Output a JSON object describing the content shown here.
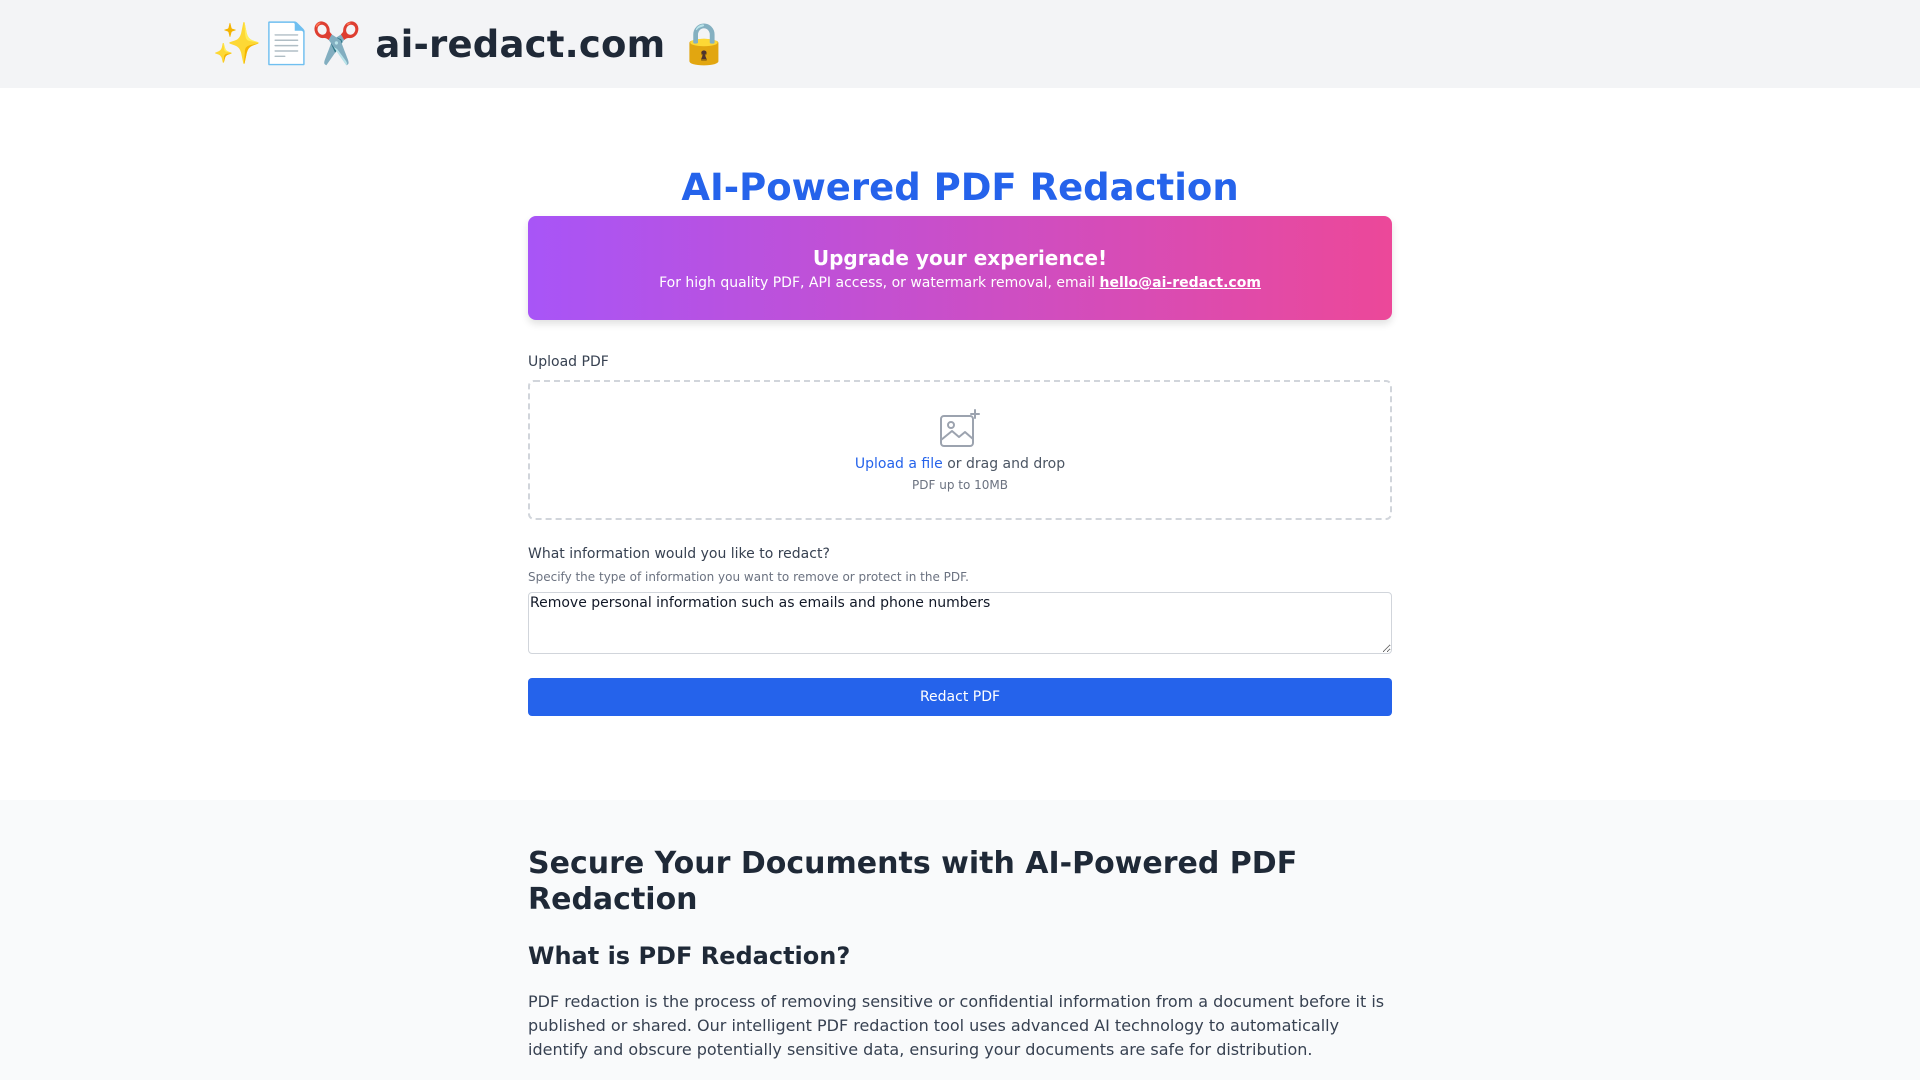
{
  "header": {
    "logo_emoji_left": "✨📄✂️",
    "logo_text": "ai-redact.com",
    "logo_emoji_right": "🔒"
  },
  "main": {
    "title": "AI-Powered PDF Redaction",
    "banner": {
      "title": "Upgrade your experience!",
      "text": "For high quality PDF, API access, or watermark removal, email ",
      "email": "hello@ai-redact.com"
    },
    "upload": {
      "label": "Upload PDF",
      "link_text": "Upload a file",
      "drag_text": " or drag and drop",
      "hint": "PDF up to 10MB",
      "icon": "image-plus-icon"
    },
    "redact": {
      "label": "What information would you like to redact?",
      "helper": "Specify the type of information you want to remove or protect in the PDF.",
      "value": "Remove personal information such as emails and phone numbers"
    },
    "button_label": "Redact PDF"
  },
  "info": {
    "heading": "Secure Your Documents with AI-Powered PDF Redaction",
    "subheading": "What is PDF Redaction?",
    "paragraph": "PDF redaction is the process of removing sensitive or confidential information from a document before it is published or shared. Our intelligent PDF redaction tool uses advanced AI technology to automatically identify and obscure potentially sensitive data, ensuring your documents are safe for distribution."
  },
  "colors": {
    "accent": "#2563eb",
    "banner_start": "#a855f7",
    "banner_end": "#ec4899"
  }
}
